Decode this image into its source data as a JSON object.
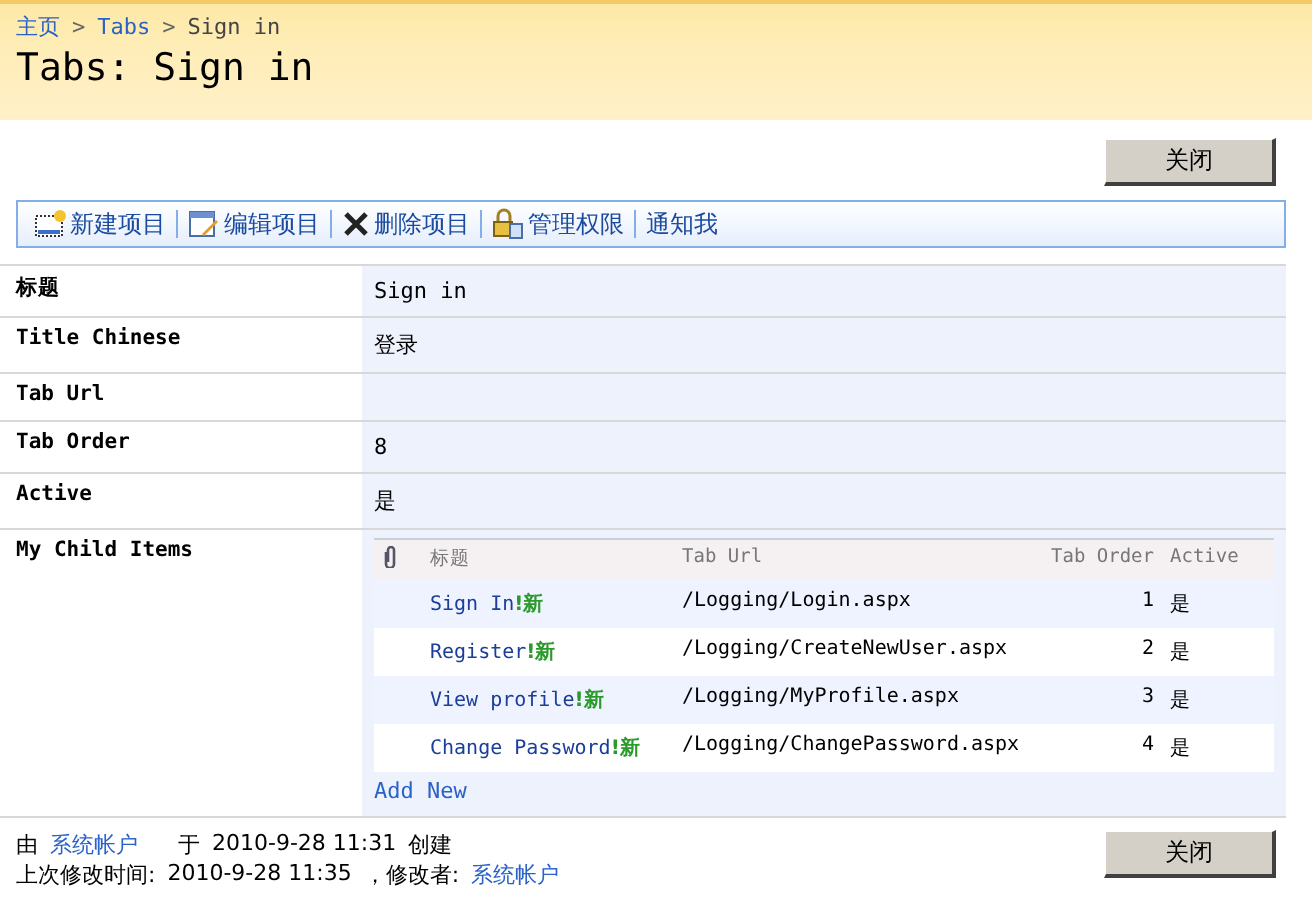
{
  "breadcrumb": [
    {
      "label": "主页"
    },
    {
      "label": "Tabs"
    },
    {
      "label": "Sign in"
    }
  ],
  "breadcrumb_separator": ">",
  "page_title": "Tabs: Sign in",
  "close_button": "关闭",
  "toolbar": [
    {
      "label": "新建项目",
      "kind": "new"
    },
    {
      "label": "编辑项目",
      "kind": "edit"
    },
    {
      "label": "删除项目",
      "kind": "delete"
    },
    {
      "label": "管理权限",
      "kind": "permissions"
    },
    {
      "label": "通知我",
      "kind": "alert"
    }
  ],
  "fields": [
    {
      "label": "标题",
      "value": "Sign in"
    },
    {
      "label": "Title Chinese",
      "value": "登录"
    },
    {
      "label": "Tab Url"
    },
    {
      "label": "Tab Order",
      "value": "8"
    },
    {
      "label": "Active",
      "value": "是"
    }
  ],
  "child_items": {
    "label": "My Child Items",
    "columns": [
      "标题",
      "Tab Url",
      "Tab Order",
      "Active"
    ],
    "rows": [
      {
        "title": "Sign In",
        "new_mark": "!新",
        "url": "/Logging/Login.aspx",
        "order": "1",
        "active": "是"
      },
      {
        "title": "Register",
        "new_mark": "!新",
        "url": "/Logging/CreateNewUser.aspx",
        "order": "2",
        "active": "是"
      },
      {
        "title": "View profile",
        "new_mark": "!新",
        "url": "/Logging/MyProfile.aspx",
        "order": "3",
        "active": "是"
      },
      {
        "title": "Change Password",
        "new_mark": "!新",
        "url": "/Logging/ChangePassword.aspx",
        "order": "4",
        "active": "是"
      }
    ],
    "add_new": "Add New"
  },
  "footer": {
    "created": {
      "by_label": "由",
      "user": "系统帐户",
      "at_label": "于",
      "time": "2010-9-28 11:31",
      "action": "创建"
    },
    "modified": {
      "label": "上次修改时间:",
      "time": "2010-9-28 11:35",
      "by_label": "，修改者:",
      "user": "系统帐户"
    }
  },
  "footer_close_button": "关闭"
}
